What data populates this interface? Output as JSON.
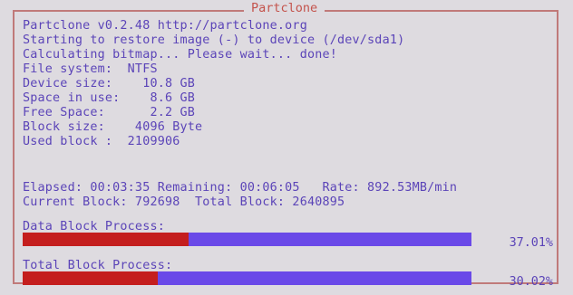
{
  "window": {
    "title": "Partclone"
  },
  "info": {
    "line1": "Partclone v0.2.48 http://partclone.org",
    "line2": "Starting to restore image (-) to device (/dev/sda1)",
    "line3": "Calculating bitmap... Please wait... done!",
    "file_system": "File system:  NTFS",
    "device_size": "Device size:    10.8 GB",
    "space_in_use": "Space in use:    8.6 GB",
    "free_space": "Free Space:      2.2 GB",
    "block_size": "Block size:    4096 Byte",
    "used_block": "Used block :  2109906"
  },
  "status": {
    "elapsed_line": "Elapsed: 00:03:35 Remaining: 00:06:05   Rate: 892.53MB/min",
    "block_line": "Current Block: 792698  Total Block: 2640895"
  },
  "progress": {
    "data_label": "Data Block Process:",
    "data_percent_text": "37.01%",
    "data_fraction": 0.3701,
    "total_label": "Total Block Process:",
    "total_percent_text": "30.02%",
    "total_fraction": 0.3002
  },
  "colors": {
    "background": "#dedbe0",
    "text": "#5b44b8",
    "title": "#c4534c",
    "frame": "#c07a7a",
    "bar_done": "#c41e1e",
    "bar_remaining": "#6a49e8"
  }
}
